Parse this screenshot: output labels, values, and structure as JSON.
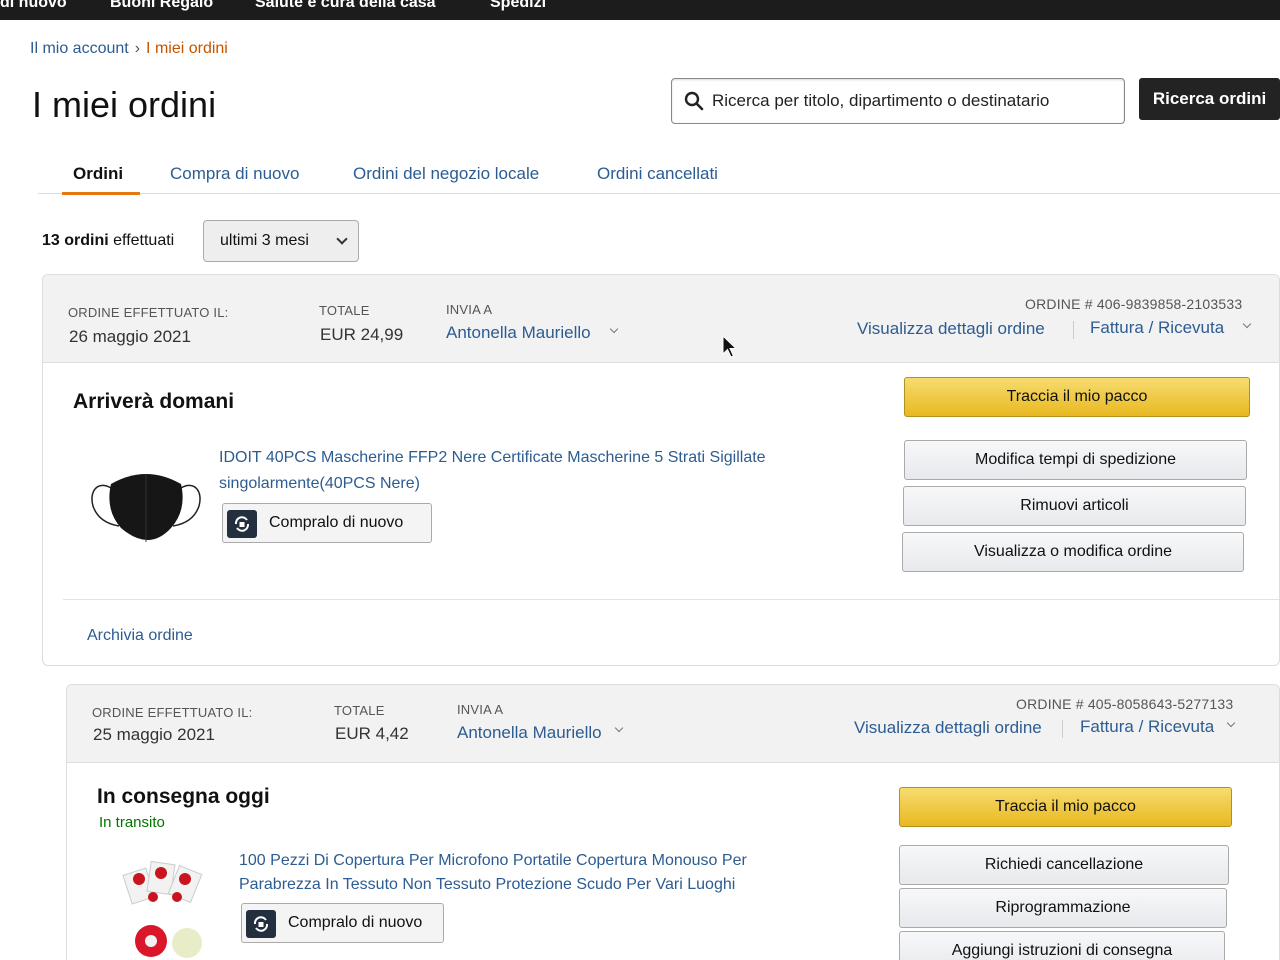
{
  "top_nav": {
    "items": [
      "di nuovo",
      "Buoni Regalo",
      "Salute e cura della casa",
      "Spedizi"
    ]
  },
  "breadcrumb": {
    "account": "Il mio account",
    "separator": "›",
    "current": "I miei ordini"
  },
  "page_title": "I miei ordini",
  "search": {
    "placeholder": "Ricerca per titolo, dipartimento o destinatario",
    "button_label": "Ricerca ordini"
  },
  "tabs": [
    {
      "label": "Ordini",
      "active": true
    },
    {
      "label": "Compra di nuovo",
      "active": false
    },
    {
      "label": "Ordini del negozio locale",
      "active": false
    },
    {
      "label": "Ordini cancellati",
      "active": false
    }
  ],
  "filter": {
    "count_bold": "13 ordini",
    "count_rest": " effettuati",
    "period": "ultimi 3 mesi"
  },
  "orders": [
    {
      "placed_label": "ORDINE EFFETTUATO IL:",
      "placed_date": "26 maggio 2021",
      "total_label": "TOTALE",
      "total": "EUR 24,99",
      "ship_label": "INVIA A",
      "ship_to": "Antonella Mauriello",
      "order_number": "ORDINE # 406-9839858-2103533",
      "details_link": "Visualizza dettagli ordine",
      "invoice_link": "Fattura / Ricevuta",
      "status": "Arriverà domani",
      "product_title": "IDOIT 40PCS Mascherine FFP2 Nere Certificate Mascherine 5 Strati Sigillate singolarmente(40PCS Nere)",
      "buy_again": "Compralo di nuovo",
      "primary_action": "Traccia il mio pacco",
      "actions": [
        "Modifica tempi di spedizione",
        "Rimuovi articoli",
        "Visualizza o modifica ordine"
      ],
      "archive": "Archivia ordine"
    },
    {
      "placed_label": "ORDINE EFFETTUATO IL:",
      "placed_date": "25 maggio 2021",
      "total_label": "TOTALE",
      "total": "EUR 4,42",
      "ship_label": "INVIA A",
      "ship_to": "Antonella Mauriello",
      "order_number": "ORDINE # 405-8058643-5277133",
      "details_link": "Visualizza dettagli ordine",
      "invoice_link": "Fattura / Ricevuta",
      "status": "In consegna oggi",
      "substatus": "In transito",
      "product_title": "100 Pezzi Di Copertura Per Microfono Portatile Copertura Monouso Per Parabrezza In Tessuto Non Tessuto Protezione Scudo Per Vari Luoghi",
      "buy_again": "Compralo di nuovo",
      "primary_action": "Traccia il mio pacco",
      "actions": [
        "Richiedi cancellazione",
        "Riprogrammazione",
        "Aggiungi istruzioni di consegna"
      ]
    }
  ],
  "colors": {
    "link": "#2c5c91",
    "accent_tab": "#e47911",
    "primary_button": "#f0c14b",
    "in_transit": "#007600",
    "breadcrumb_current": "#c45500"
  }
}
